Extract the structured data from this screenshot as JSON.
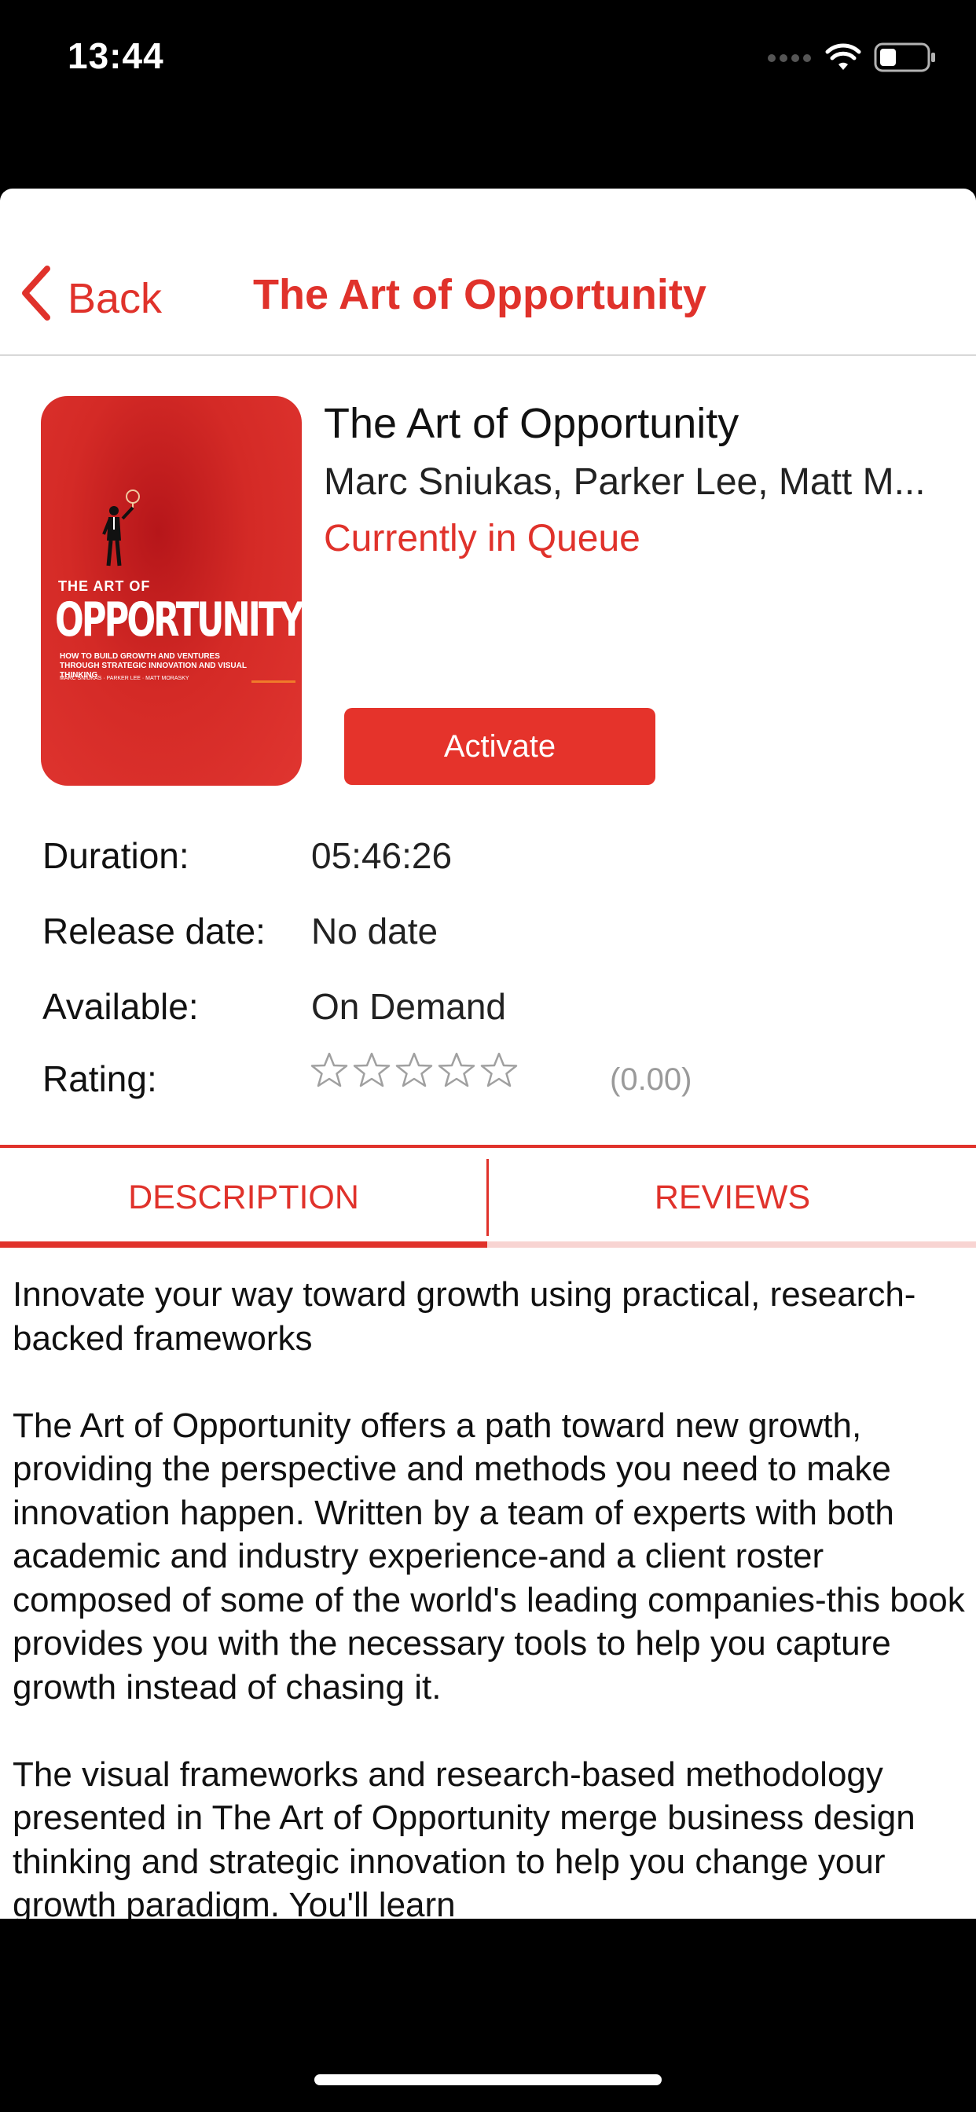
{
  "status_bar": {
    "time": "13:44"
  },
  "nav": {
    "back_label": "Back",
    "title": "The Art of Opportunity"
  },
  "book": {
    "title": "The Art of Opportunity",
    "authors": "Marc Sniukas, Parker Lee, Matt M...",
    "status": "Currently in Queue",
    "activate_label": "Activate",
    "cover": {
      "title_small": "THE ART OF",
      "title_big": "OPPORTUNITY",
      "subtitle": "HOW TO BUILD GROWTH AND VENTURES THROUGH STRATEGIC INNOVATION AND VISUAL THINKING",
      "authors": "MARC SNIUKAS · PARKER LEE · MATT MORASKY",
      "background_color": "#d42a26"
    }
  },
  "details": {
    "duration_label": "Duration:",
    "duration_value": "05:46:26",
    "release_label": "Release date:",
    "release_value": "No date",
    "available_label": "Available:",
    "available_value": "On Demand",
    "rating_label": "Rating:",
    "rating_stars_filled": 0,
    "rating_stars_total": 5,
    "rating_value": "(0.00)"
  },
  "tabs": {
    "description_label": "DESCRIPTION",
    "reviews_label": "REVIEWS",
    "active": "DESCRIPTION"
  },
  "description": "Innovate your way toward growth using practical, research-backed frameworks\n\nThe Art of Opportunity offers a path toward new growth, providing the perspective and methods you need to make innovation happen. Written by a team of experts with both academic and industry experience-and a client roster composed of some of the world's leading companies-this book provides you with the necessary tools to help you capture growth instead of chasing it.\n\nThe visual frameworks and research-based methodology presented in The Art of Opportunity merge business design thinking and strategic innovation to help you change your growth paradigm. You'll learn",
  "colors": {
    "accent": "#e0322b",
    "button": "#e5332b",
    "tab_inactive_indicator": "#f8d4d2",
    "rating_gray": "#9a9a9a"
  }
}
